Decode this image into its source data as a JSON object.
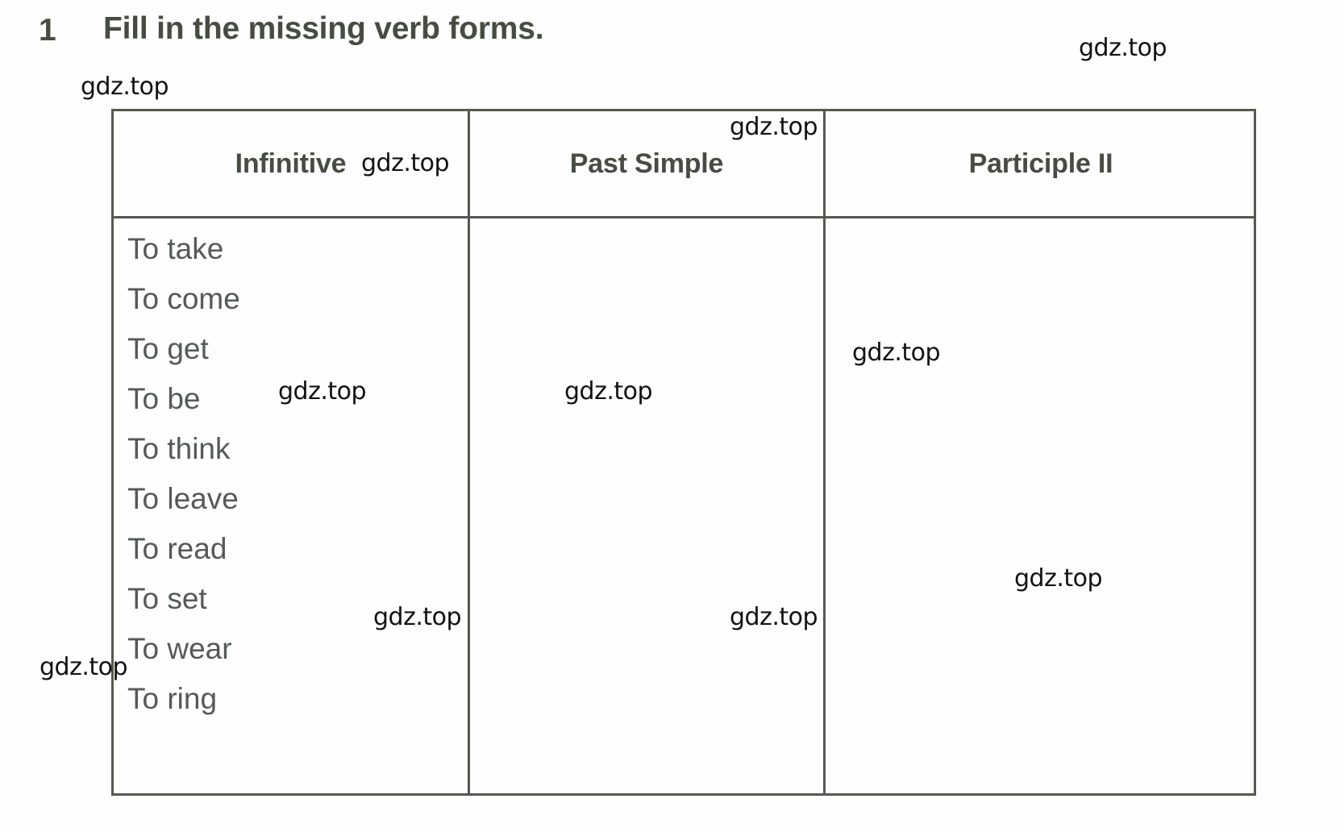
{
  "exercise": {
    "number": "1",
    "title": "Fill in the missing verb forms."
  },
  "table": {
    "headers": [
      "Infinitive",
      "Past Simple",
      "Participle II"
    ],
    "rows": [
      {
        "infinitive": "To take",
        "past_simple": "",
        "participle_ii": ""
      },
      {
        "infinitive": "To come",
        "past_simple": "",
        "participle_ii": ""
      },
      {
        "infinitive": "To get",
        "past_simple": "",
        "participle_ii": ""
      },
      {
        "infinitive": "To be",
        "past_simple": "",
        "participle_ii": ""
      },
      {
        "infinitive": "To think",
        "past_simple": "",
        "participle_ii": ""
      },
      {
        "infinitive": "To leave",
        "past_simple": "",
        "participle_ii": ""
      },
      {
        "infinitive": "To read",
        "past_simple": "",
        "participle_ii": ""
      },
      {
        "infinitive": "To set",
        "past_simple": "",
        "participle_ii": ""
      },
      {
        "infinitive": "To wear",
        "past_simple": "",
        "participle_ii": ""
      },
      {
        "infinitive": "To ring",
        "past_simple": "",
        "participle_ii": ""
      }
    ]
  },
  "watermarks": [
    {
      "id": "wm-top-right",
      "text": "gdz.top"
    },
    {
      "id": "wm-above-table",
      "text": "gdz.top"
    },
    {
      "id": "wm-infinitive",
      "text": "gdz.top"
    },
    {
      "id": "wm-past-header",
      "text": "gdz.top"
    },
    {
      "id": "wm-col1-mid",
      "text": "gdz.top"
    },
    {
      "id": "wm-col2-mid",
      "text": "gdz.top"
    },
    {
      "id": "wm-col3-upper",
      "text": "gdz.top"
    },
    {
      "id": "wm-col3-lower",
      "text": "gdz.top"
    },
    {
      "id": "wm-col1-low",
      "text": "gdz.top"
    },
    {
      "id": "wm-col2-low",
      "text": "gdz.top"
    },
    {
      "id": "wm-left-edge",
      "text": "gdz.top"
    }
  ],
  "colors": {
    "heading_text": "#474c42",
    "body_text": "#55595a",
    "table_border": "#55594f",
    "background": "#fefefe",
    "watermark": "#111111"
  }
}
